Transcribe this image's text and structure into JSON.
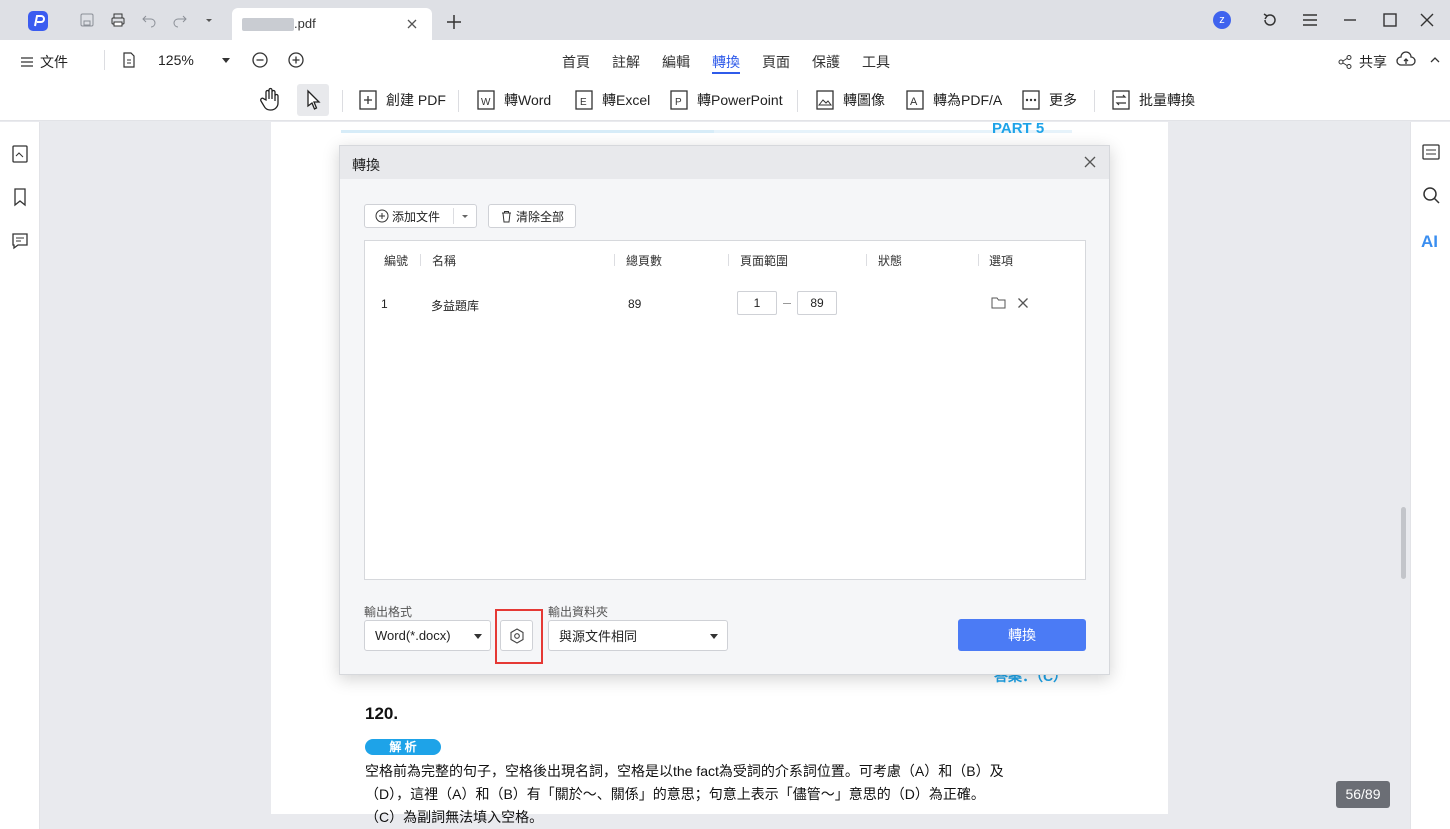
{
  "titlebar": {
    "tab_name": ".pdf",
    "avatar_letter": "z"
  },
  "menubar": {
    "file_label": "文件",
    "zoom_value": "125%",
    "tabs": [
      "首頁",
      "註解",
      "編輯",
      "轉換",
      "頁面",
      "保護",
      "工具"
    ],
    "active_tab": "轉換",
    "share_label": "共享"
  },
  "toolbar": {
    "create_pdf": "創建 PDF",
    "to_word": "轉Word",
    "to_excel": "轉Excel",
    "to_ppt": "轉PowerPoint",
    "to_image": "轉圖像",
    "to_pdfa": "轉為PDF/A",
    "more": "更多",
    "batch_convert": "批量轉換"
  },
  "document": {
    "part_label": "PART 5",
    "answer_fragment": "答案：（C）",
    "question_number": "120.",
    "analysis_badge": "解 析",
    "line1": "空格前為完整的句子，空格後出現名詞，空格是以the fact為受詞的介系詞位置。可考慮（A）和（B）及",
    "line2": "（D），這裡（A）和（B）有「關於～、關係」的意思；句意上表示「儘管～」意思的（D）為正確。",
    "line3": "（C）為副詞無法填入空格。"
  },
  "dialog": {
    "title": "轉換",
    "add_file": "添加文件",
    "clear_all": "清除全部",
    "columns": {
      "num": "編號",
      "name": "名稱",
      "pages": "總頁數",
      "range": "頁面範圍",
      "status": "狀態",
      "options": "選項"
    },
    "rows": [
      {
        "num": "1",
        "name": "多益題库",
        "pages": "89",
        "range_from": "1",
        "range_to": "89"
      }
    ],
    "output_format_label": "輸出格式",
    "output_format_value": "Word(*.docx)",
    "output_folder_label": "輸出資料夾",
    "output_folder_value": "與源文件相同",
    "convert_button": "轉換"
  },
  "status": {
    "page_indicator": "56/89"
  },
  "colors": {
    "accent": "#2f5bea",
    "convert_button": "#4b7bf5",
    "highlight_border": "#e53935",
    "page_part_blue": "#1ea3e8"
  },
  "icons": [
    "app-logo-icon",
    "save-icon",
    "print-icon",
    "undo-icon",
    "redo-icon",
    "close-icon",
    "plus-icon",
    "refresh-icon",
    "menu-icon",
    "minimize-icon",
    "maximize-icon",
    "page-icon",
    "zoom-out-icon",
    "zoom-in-icon",
    "share-icon",
    "cloud-upload-icon",
    "hand-tool-icon",
    "select-cursor-icon",
    "folder-icon",
    "settings-icon",
    "ai-icon"
  ]
}
